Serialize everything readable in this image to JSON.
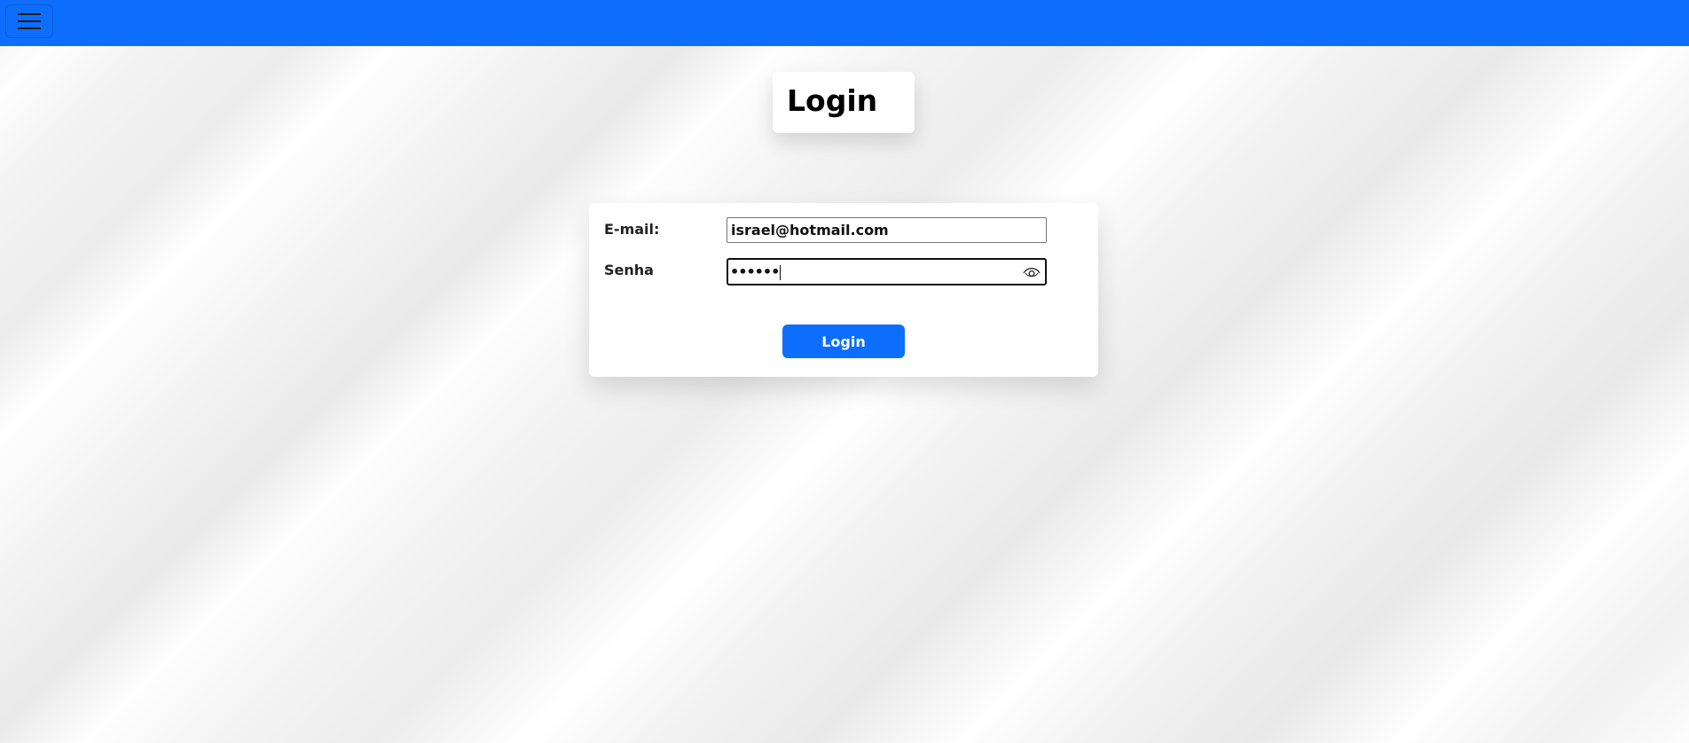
{
  "navbar": {
    "color": "#0d6efd",
    "toggle_icon": "hamburger-menu-icon"
  },
  "title": "Login",
  "form": {
    "email_label": "E-mail:",
    "email_value": "israel@hotmail.com",
    "password_label": "Senha",
    "password_masked": "••••••",
    "eye_icon": "eye-icon",
    "submit_label": "Login",
    "accent_color": "#0d6efd"
  }
}
